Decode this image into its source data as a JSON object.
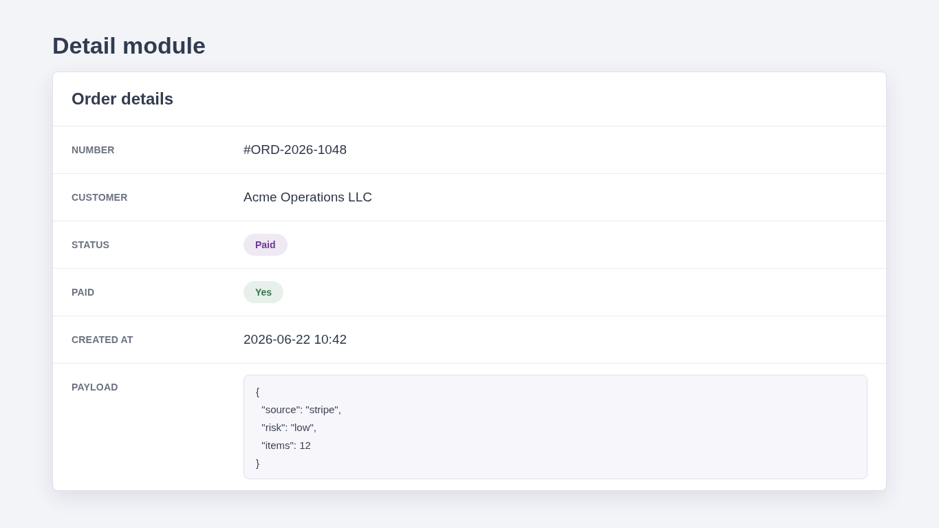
{
  "page": {
    "title": "Detail module"
  },
  "card": {
    "title": "Order details",
    "fields": [
      {
        "label": "NUMBER",
        "kind": "text",
        "value": "#ORD-2026-1048"
      },
      {
        "label": "CUSTOMER",
        "kind": "text",
        "value": "Acme Operations LLC"
      },
      {
        "label": "STATUS",
        "kind": "badge",
        "value": "Paid",
        "color": "#6b3a96"
      },
      {
        "label": "PAID",
        "kind": "badge",
        "value": "Yes",
        "color": "#2f7a4a"
      },
      {
        "label": "CREATED AT",
        "kind": "text",
        "value": "2026-06-22 10:42"
      },
      {
        "label": "PAYLOAD",
        "kind": "code",
        "value": "{\n  \"source\": \"stripe\",\n  \"risk\": \"low\",\n  \"items\": 12\n}"
      }
    ]
  }
}
